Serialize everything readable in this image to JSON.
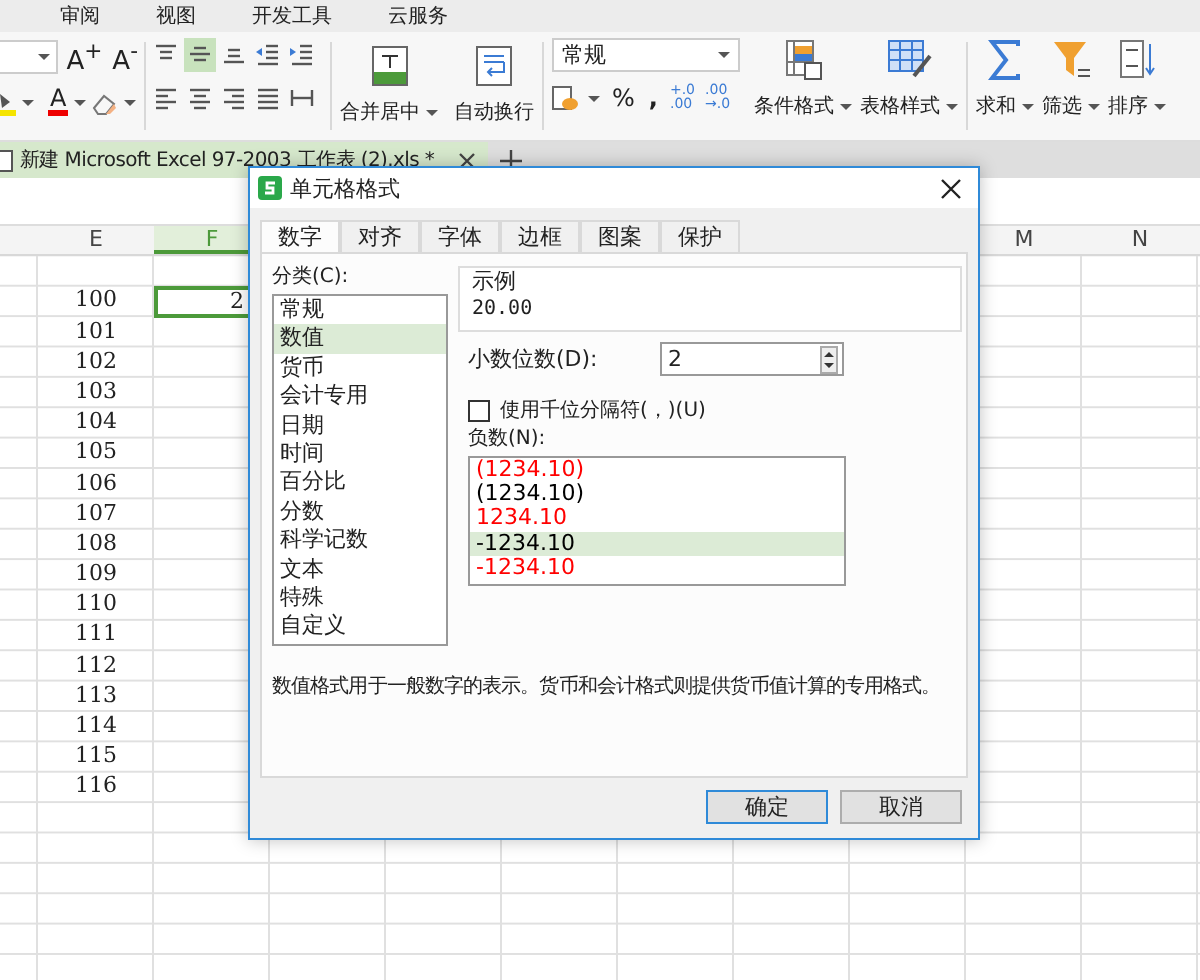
{
  "menu": [
    {
      "label": "审阅"
    },
    {
      "label": "视图"
    },
    {
      "label": "开发工具"
    },
    {
      "label": "云服务"
    }
  ],
  "ribbon": {
    "font_grow": "A$^{+}$",
    "font_shrink": "A$^{-}$",
    "font_color": "A",
    "align_buttons": [
      {
        "kind": "top",
        "selected": false
      },
      {
        "kind": "middle",
        "selected": true
      },
      {
        "kind": "bottom",
        "selected": false
      },
      {
        "kind": "outdent",
        "selected": false
      },
      {
        "kind": "indent",
        "selected": false
      },
      {
        "kind": "left",
        "selected": false
      },
      {
        "kind": "center",
        "selected": false
      },
      {
        "kind": "right",
        "selected": false
      },
      {
        "kind": "justify",
        "selected": false
      },
      {
        "kind": "distributed",
        "selected": false
      }
    ],
    "merge": "合并居中",
    "wrap": "自动换行",
    "number_format": "常规",
    "percent": "%",
    "comma": ",",
    "increase_decimal": [
      "+.0",
      ".00"
    ],
    "decrease_decimal": [
      ".00",
      "→.0"
    ],
    "big_buttons": [
      {
        "kind": "conditional",
        "label": "条件格式"
      },
      {
        "kind": "table_style",
        "label": "表格样式"
      },
      {
        "kind": "sum",
        "label": "求和"
      },
      {
        "kind": "filter",
        "label": "筛选"
      },
      {
        "kind": "sort",
        "label": "排序"
      }
    ]
  },
  "document_tab": {
    "title": "新建 Microsoft Excel 97-2003 工作表 (2).xls *"
  },
  "sheet": {
    "columns": [
      {
        "label": "E",
        "selected": false
      },
      {
        "label": "F",
        "selected": true
      },
      {
        "label": "M",
        "selected": false
      },
      {
        "label": "N",
        "selected": false
      }
    ],
    "rows": [
      {
        "e": "100",
        "f": "2",
        "active": true
      },
      {
        "e": "101",
        "active": false
      },
      {
        "e": "102",
        "active": false
      },
      {
        "e": "103",
        "active": false
      },
      {
        "e": "104",
        "active": false
      },
      {
        "e": "105",
        "active": false
      },
      {
        "e": "106",
        "active": false
      },
      {
        "e": "107",
        "active": false
      },
      {
        "e": "108",
        "active": false
      },
      {
        "e": "109",
        "active": false
      },
      {
        "e": "110",
        "active": false
      },
      {
        "e": "111",
        "active": false
      },
      {
        "e": "112",
        "active": false
      },
      {
        "e": "113",
        "active": false
      },
      {
        "e": "114",
        "active": false
      },
      {
        "e": "115",
        "active": false
      },
      {
        "e": "116",
        "active": false
      }
    ]
  },
  "dialog": {
    "title": "单元格格式",
    "tabs": [
      {
        "label": "数字",
        "selected": true
      },
      {
        "label": "对齐",
        "selected": false
      },
      {
        "label": "字体",
        "selected": false
      },
      {
        "label": "边框",
        "selected": false
      },
      {
        "label": "图案",
        "selected": false
      },
      {
        "label": "保护",
        "selected": false
      }
    ],
    "category_label": "分类(C):",
    "categories": [
      {
        "label": "常规",
        "selected": false
      },
      {
        "label": "数值",
        "selected": true
      },
      {
        "label": "货币",
        "selected": false
      },
      {
        "label": "会计专用",
        "selected": false
      },
      {
        "label": "日期",
        "selected": false
      },
      {
        "label": "时间",
        "selected": false
      },
      {
        "label": "百分比",
        "selected": false
      },
      {
        "label": "分数",
        "selected": false
      },
      {
        "label": "科学记数",
        "selected": false
      },
      {
        "label": "文本",
        "selected": false
      },
      {
        "label": "特殊",
        "selected": false
      },
      {
        "label": "自定义",
        "selected": false
      }
    ],
    "sample_label": "示例",
    "sample": "20.00",
    "decimals_label": "小数位数(D):",
    "decimals": "2",
    "thousands": {
      "label": "使用千位分隔符(，)(U)",
      "checked": false
    },
    "negative_label": "负数(N):",
    "negatives": [
      {
        "text": "(1234.10)",
        "color": "#ff0000",
        "selected": false
      },
      {
        "text": "(1234.10)",
        "color": "#000000",
        "selected": false
      },
      {
        "text": "1234.10",
        "color": "#ff0000",
        "selected": false
      },
      {
        "text": "-1234.10",
        "color": "#000000",
        "selected": true
      },
      {
        "text": "-1234.10",
        "color": "#ff0000",
        "selected": false
      }
    ],
    "description": "数值格式用于一般数字的表示。货币和会计格式则提供货币值计算的专用格式。",
    "buttons": [
      {
        "label": "确定",
        "default": true
      },
      {
        "label": "取消",
        "default": false
      }
    ]
  }
}
